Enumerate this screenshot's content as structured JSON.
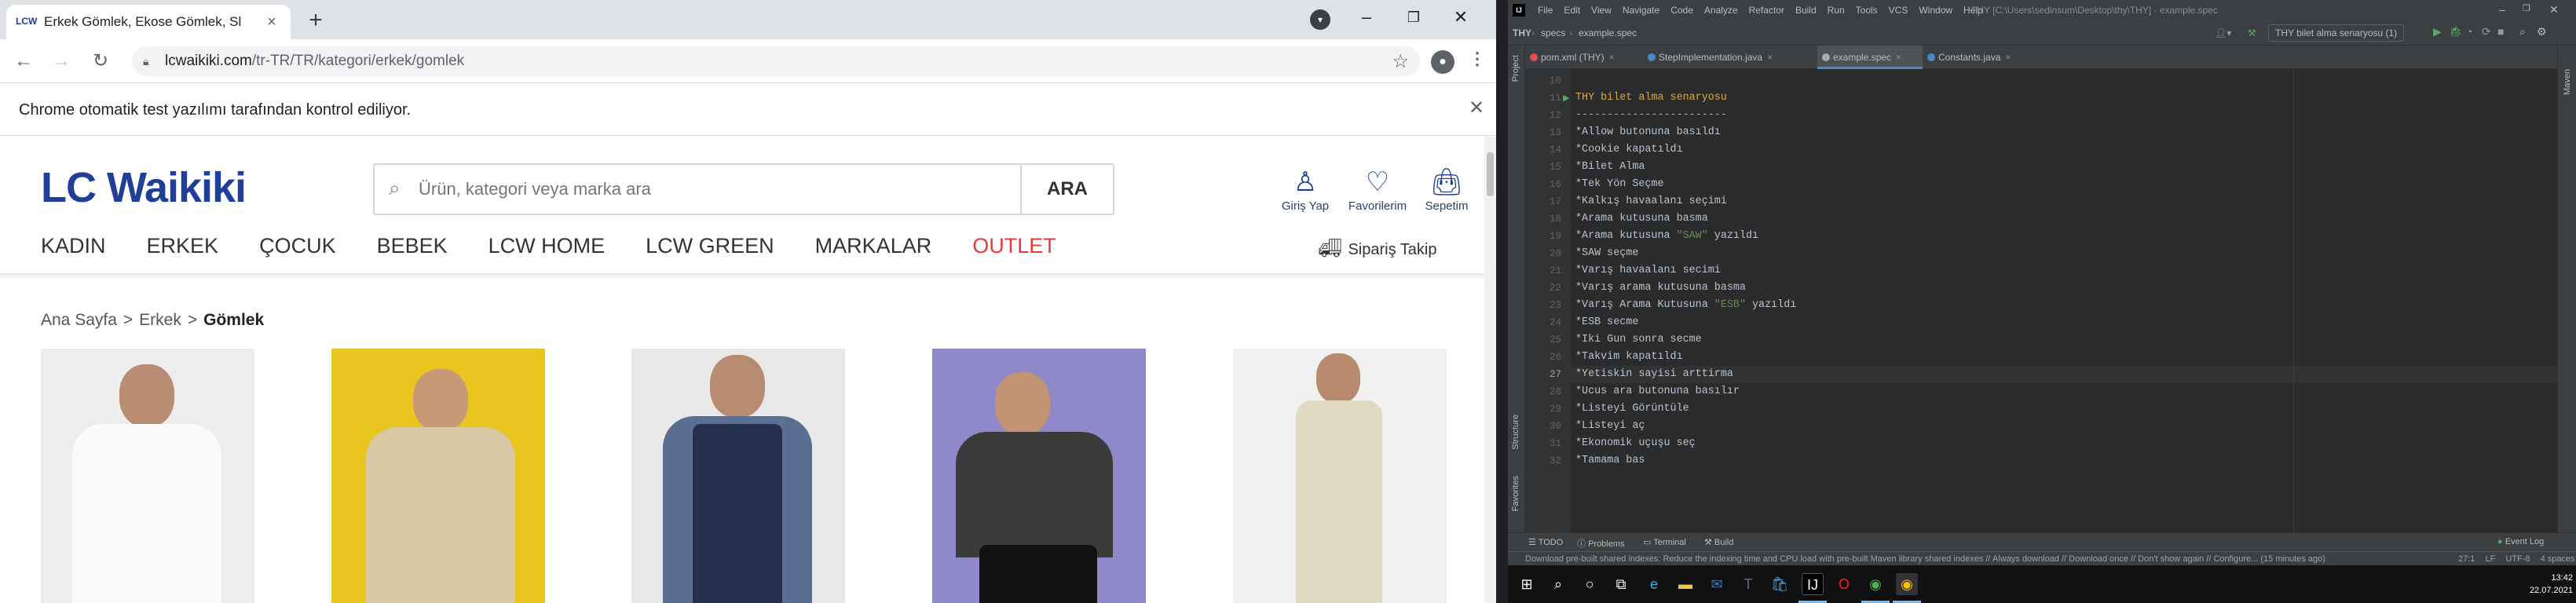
{
  "chrome": {
    "tab_title": "Erkek Gömlek, Ekose Gömlek, Sl",
    "tab_favicon": "LCW",
    "url_host": "lcwaikiki.com",
    "url_path": "/tr-TR/TR/kategori/erkek/gomlek",
    "infobar_text": "Chrome otomatik test yazılımı tarafından kontrol ediliyor.",
    "icons": [
      "back-icon",
      "forward-icon",
      "reload-icon",
      "lock-icon",
      "star-icon",
      "profile-icon",
      "menu-icon",
      "close-icon",
      "tab-search-icon"
    ]
  },
  "site": {
    "logo": "LC Waikiki",
    "search_placeholder": "Ürün, kategori veya marka ara",
    "search_button": "ARA",
    "header_actions": [
      {
        "label": "Giriş Yap",
        "icon": "user-icon"
      },
      {
        "label": "Favorilerim",
        "icon": "heart-icon"
      },
      {
        "label": "Sepetim",
        "icon": "bag-icon"
      }
    ],
    "nav": [
      "KADIN",
      "ERKEK",
      "ÇOCUK",
      "BEBEK",
      "LCW HOME",
      "LCW GREEN",
      "MARKALAR",
      "OUTLET"
    ],
    "order_tracking": "Sipariş Takip",
    "breadcrumb": [
      "Ana Sayfa",
      "Erkek",
      "Gömlek"
    ],
    "accent_colors": {
      "brand": "#1f3f99",
      "outlet": "#e8373d"
    }
  },
  "ide": {
    "menu": [
      "File",
      "Edit",
      "View",
      "Navigate",
      "Code",
      "Analyze",
      "Refactor",
      "Build",
      "Run",
      "Tools",
      "VCS",
      "Window",
      "Help"
    ],
    "title_path": "THY [C:\\Users\\sedinsum\\Desktop\\thy\\THY] - example.spec",
    "breadcrumbs": [
      "THY",
      "specs",
      "example.spec"
    ],
    "run_config": "THY bilet alma senaryosu (1)",
    "tabs": [
      {
        "label": "pom.xml (THY)",
        "active": false
      },
      {
        "label": "StepImplementation.java",
        "active": false
      },
      {
        "label": "example.spec",
        "active": true
      },
      {
        "label": "Constants.java",
        "active": false
      }
    ],
    "lines": [
      {
        "num": "10",
        "text": ""
      },
      {
        "num": "11",
        "text": "THY bilet alma senaryosu",
        "kind": "title"
      },
      {
        "num": "12",
        "text": "------------------------",
        "kind": "under"
      },
      {
        "num": "13",
        "text": "*Allow butonuna basıldı"
      },
      {
        "num": "14",
        "text": "*Cookie kapatıldı"
      },
      {
        "num": "15",
        "text": "*Bilet Alma"
      },
      {
        "num": "16",
        "text": "*Tek Yön Seçme"
      },
      {
        "num": "17",
        "text": "*Kalkış havaalanı seçimi"
      },
      {
        "num": "18",
        "text": "*Arama kutusuna basma"
      },
      {
        "num": "19",
        "text": "*Arama kutusuna ",
        "str": "\"SAW\"",
        "tail": " yazıldı"
      },
      {
        "num": "20",
        "text": "*SAW seçme"
      },
      {
        "num": "21",
        "text": "*Varış havaalanı secimi"
      },
      {
        "num": "22",
        "text": "*Varış arama kutusuna basma"
      },
      {
        "num": "23",
        "text": "*Varış Arama Kutusuna ",
        "str": "\"ESB\"",
        "tail": " yazıldı"
      },
      {
        "num": "24",
        "text": "*ESB secme"
      },
      {
        "num": "25",
        "text": "*Iki Gun sonra secme"
      },
      {
        "num": "26",
        "text": "*Takvim kapatıldı"
      },
      {
        "num": "27",
        "text": "*Yetiskin sayisi arttirma",
        "current": true
      },
      {
        "num": "28",
        "text": "*Ucus ara butonuna basılır"
      },
      {
        "num": "29",
        "text": "*Listeyi Görüntüle"
      },
      {
        "num": "30",
        "text": "*Listeyi aç"
      },
      {
        "num": "31",
        "text": "*Ekonomik uçuşu seç"
      },
      {
        "num": "32",
        "text": "*Tamama bas"
      }
    ],
    "tool_windows": [
      "TODO",
      "Problems",
      "Terminal",
      "Build"
    ],
    "left_tools": [
      "Project",
      "Structure",
      "Favorites"
    ],
    "event_log": "Event Log",
    "status_message": "Download pre-built shared indexes: Reduce the indexing time and CPU load with pre-built Maven library shared indexes // Always download // Download once // Don't show again // Configure... (15 minutes ago)",
    "status_right": [
      "27:1",
      "LF",
      "UTF-8",
      "4 spaces"
    ]
  },
  "taskbar": {
    "time": "13:42",
    "date": "22.07.2021",
    "apps": [
      "start",
      "search",
      "cortana",
      "task-view",
      "edge",
      "file-explorer",
      "mail",
      "teams",
      "store",
      "intellij",
      "opera",
      "chrome",
      "chrome"
    ]
  }
}
